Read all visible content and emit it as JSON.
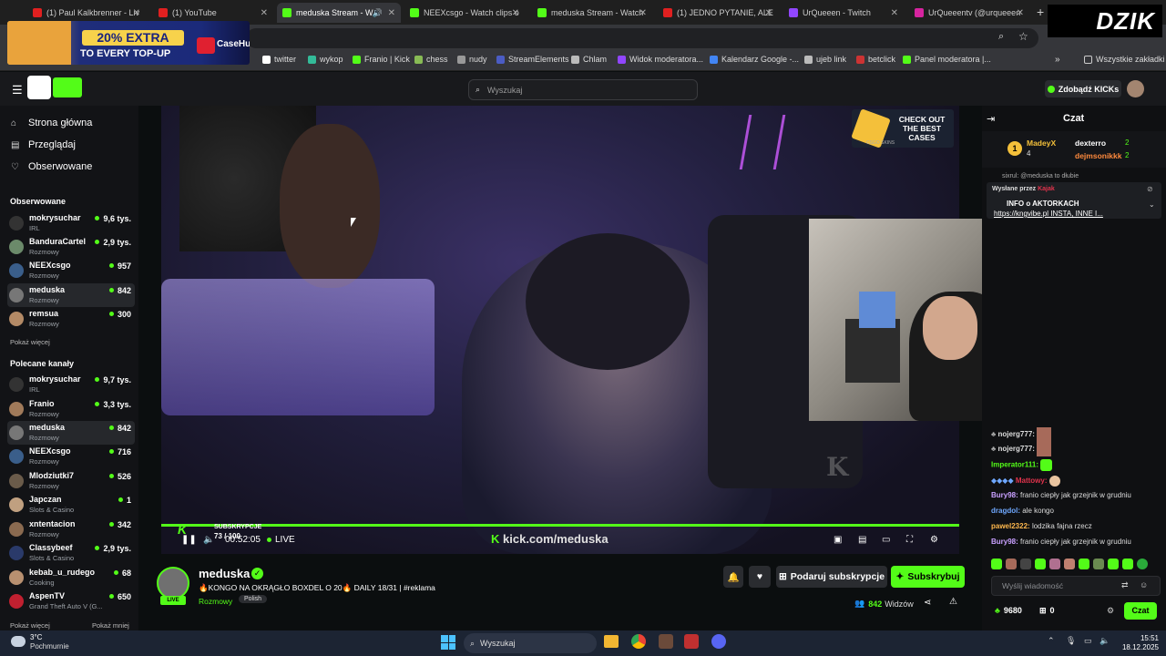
{
  "browser": {
    "tabs": [
      {
        "title": "(1) Paul Kalkbrenner - Liv",
        "color": "#e02020"
      },
      {
        "title": "(1) YouTube",
        "color": "#e02020"
      },
      {
        "title": "meduska Stream - W",
        "color": "#53fc18"
      },
      {
        "title": "NEEXcsgo - Watch clips o",
        "color": "#53fc18"
      },
      {
        "title": "meduska Stream - Watch",
        "color": "#53fc18"
      },
      {
        "title": "(1) JEDNO PYTANIE, ALE",
        "color": "#e02020"
      },
      {
        "title": "UrQueeen - Twitch",
        "color": "#9146ff"
      },
      {
        "title": "UrQueeentv (@urqueeen",
        "color": "#d6249f"
      }
    ],
    "bookmarks": [
      {
        "label": "twitter"
      },
      {
        "label": "wykop"
      },
      {
        "label": "Franio | Kick"
      },
      {
        "label": "chess"
      },
      {
        "label": "nudy"
      },
      {
        "label": "StreamElements"
      },
      {
        "label": "Chlam"
      },
      {
        "label": "Widok moderatora..."
      },
      {
        "label": "Kalendarz Google -..."
      },
      {
        "label": "ujeb link"
      },
      {
        "label": "betclick"
      },
      {
        "label": "Panel moderatora |..."
      }
    ],
    "all_bookmarks": "Wszystkie zakładki"
  },
  "ad": {
    "headline": "20% EXTRA",
    "subline": "TO EVERY TOP-UP",
    "brand": "CaseHug"
  },
  "overlay_logo": "DZIK",
  "kick": {
    "search_placeholder": "Wyszukaj",
    "get_kicks": "Zdobądź KICKs",
    "nav": [
      {
        "label": "Strona główna",
        "icon": "home-icon"
      },
      {
        "label": "Przeglądaj",
        "icon": "browse-icon"
      },
      {
        "label": "Obserwowane",
        "icon": "heart-icon"
      }
    ],
    "followed_title": "Obserwowane",
    "followed": [
      {
        "name": "mokrysuchar",
        "cat": "IRL",
        "viewers": "9,6 tys."
      },
      {
        "name": "BanduraCartel",
        "cat": "Rozmowy",
        "viewers": "2,9 tys."
      },
      {
        "name": "NEEXcsgo",
        "cat": "Rozmowy",
        "viewers": "957"
      },
      {
        "name": "meduska",
        "cat": "Rozmowy",
        "viewers": "842"
      },
      {
        "name": "remsua",
        "cat": "Rozmowy",
        "viewers": "300"
      }
    ],
    "show_more": "Pokaż więcej",
    "recommended_title": "Polecane kanały",
    "recommended": [
      {
        "name": "mokrysuchar",
        "cat": "IRL",
        "viewers": "9,7 tys."
      },
      {
        "name": "Franio",
        "cat": "Rozmowy",
        "viewers": "3,3 tys."
      },
      {
        "name": "meduska",
        "cat": "Rozmowy",
        "viewers": "842"
      },
      {
        "name": "NEEXcsgo",
        "cat": "Rozmowy",
        "viewers": "716"
      },
      {
        "name": "Mlodziutki7",
        "cat": "Rozmowy",
        "viewers": "526"
      },
      {
        "name": "Japczan",
        "cat": "Slots & Casino",
        "viewers": "1"
      },
      {
        "name": "xntentacion",
        "cat": "Rozmowy",
        "viewers": "342"
      },
      {
        "name": "Classybeef",
        "cat": "Slots & Casino",
        "viewers": "2,9 tys."
      },
      {
        "name": "kebab_u_rudego",
        "cat": "Cooking",
        "viewers": "68"
      },
      {
        "name": "AspenTV",
        "cat": "Grand Theft Auto V (G...",
        "viewers": "650"
      }
    ],
    "show_more2": "Pokaż więcej",
    "show_less": "Pokaż mniej"
  },
  "player": {
    "time": "00:52:05",
    "live": "LIVE",
    "watermark": "kick.com/meduska",
    "sub_label": "SUBSKRYPCJE",
    "sub_count": "73 / 100",
    "promo": "CHECK OUT THE BEST CASES",
    "promo_brand": "CSGO SKINS"
  },
  "stream": {
    "channel": "meduska",
    "title": "🔥KONGO NA OKRĄGŁO BOXDEL O 20🔥 DAILY 18/31 | #reklama",
    "category": "Rozmowy",
    "tag": "Polish",
    "live_badge": "LIVE",
    "gift_sub": "Podaruj subskrypcje",
    "subscribe": "Subskrybuj",
    "viewers": "842",
    "viewers_label": "Widzów"
  },
  "chat": {
    "title": "Czat",
    "leaders": [
      {
        "name": "MadeyX",
        "count": "4"
      },
      {
        "name": "dexterro",
        "count": "2"
      },
      {
        "name": "dejmsonikkk",
        "count": "2"
      }
    ],
    "pinned_by_label": "Wysłane przez",
    "pinned_by": "Kajak",
    "pinned_title": "INFO o AKTORKACH",
    "pinned_text": "https://kngvibe.pl INSTA, INNE I...",
    "partial_top": "sixrul: @meduska to dłubie",
    "messages": [
      {
        "user": "nojerg777:",
        "text": "",
        "color": "#ffffff"
      },
      {
        "user": "nojerg777:",
        "text": "",
        "color": "#ffffff"
      },
      {
        "user": "Imperator111:",
        "text": "",
        "color": "#53fc18"
      },
      {
        "user": "Mattowy:",
        "text": "",
        "color": "#e0334c"
      },
      {
        "user": "Bury98:",
        "text": "franio ciepły jak grzejnik w grudniu",
        "color": "#c9a0ff"
      },
      {
        "user": "dragdol:",
        "text": "ale kongo",
        "color": "#6fa8ff"
      },
      {
        "user": "pawel2322:",
        "text": "lodzika fajna rzecz",
        "color": "#ffb84d"
      },
      {
        "user": "Bury98:",
        "text": "franio ciepły jak grzejnik w grudniu",
        "color": "#c9a0ff"
      }
    ],
    "input_placeholder": "Wyślij wiadomość",
    "points": "9680",
    "gifts": "0",
    "send": "Czat"
  },
  "taskbar": {
    "weather_temp": "3°C",
    "weather_text": "Pochmurnie",
    "search": "Wyszukaj",
    "time": "15:51",
    "date": "18.12.2025"
  },
  "colors": {
    "kick_green": "#53fc18",
    "bg": "#0b0e0f"
  }
}
